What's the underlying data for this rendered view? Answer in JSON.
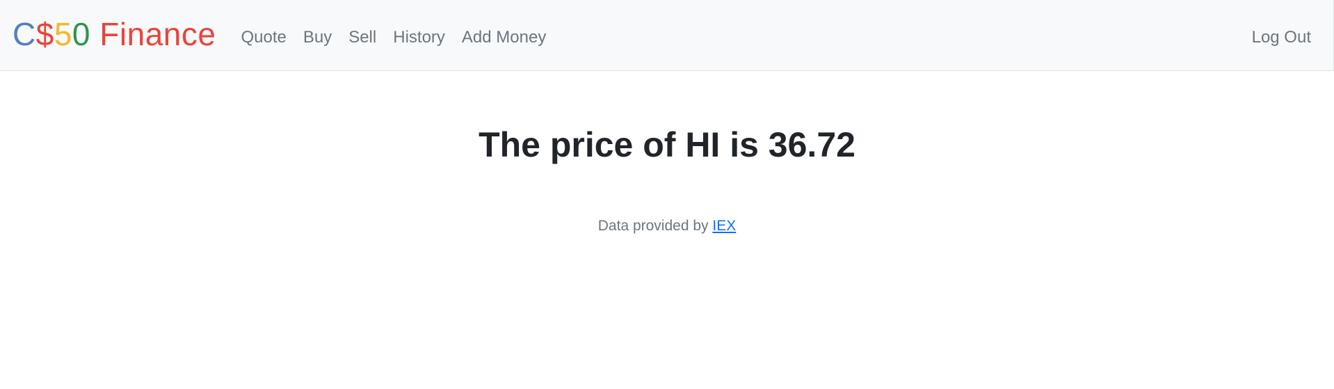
{
  "brand": {
    "parts": [
      {
        "text": "C",
        "color": "#537fbe"
      },
      {
        "text": "$",
        "color": "#ea433b"
      },
      {
        "text": "5",
        "color": "#f5b82e"
      },
      {
        "text": "0",
        "color": "#2e944b"
      },
      {
        "text": " Finance",
        "color": "#ea433b"
      }
    ]
  },
  "nav": {
    "quote": "Quote",
    "buy": "Buy",
    "sell": "Sell",
    "history": "History",
    "add_money": "Add Money",
    "logout": "Log Out"
  },
  "main": {
    "heading": "The price of HI is 36.72"
  },
  "footer": {
    "prefix": "Data provided by ",
    "link_text": "IEX"
  }
}
